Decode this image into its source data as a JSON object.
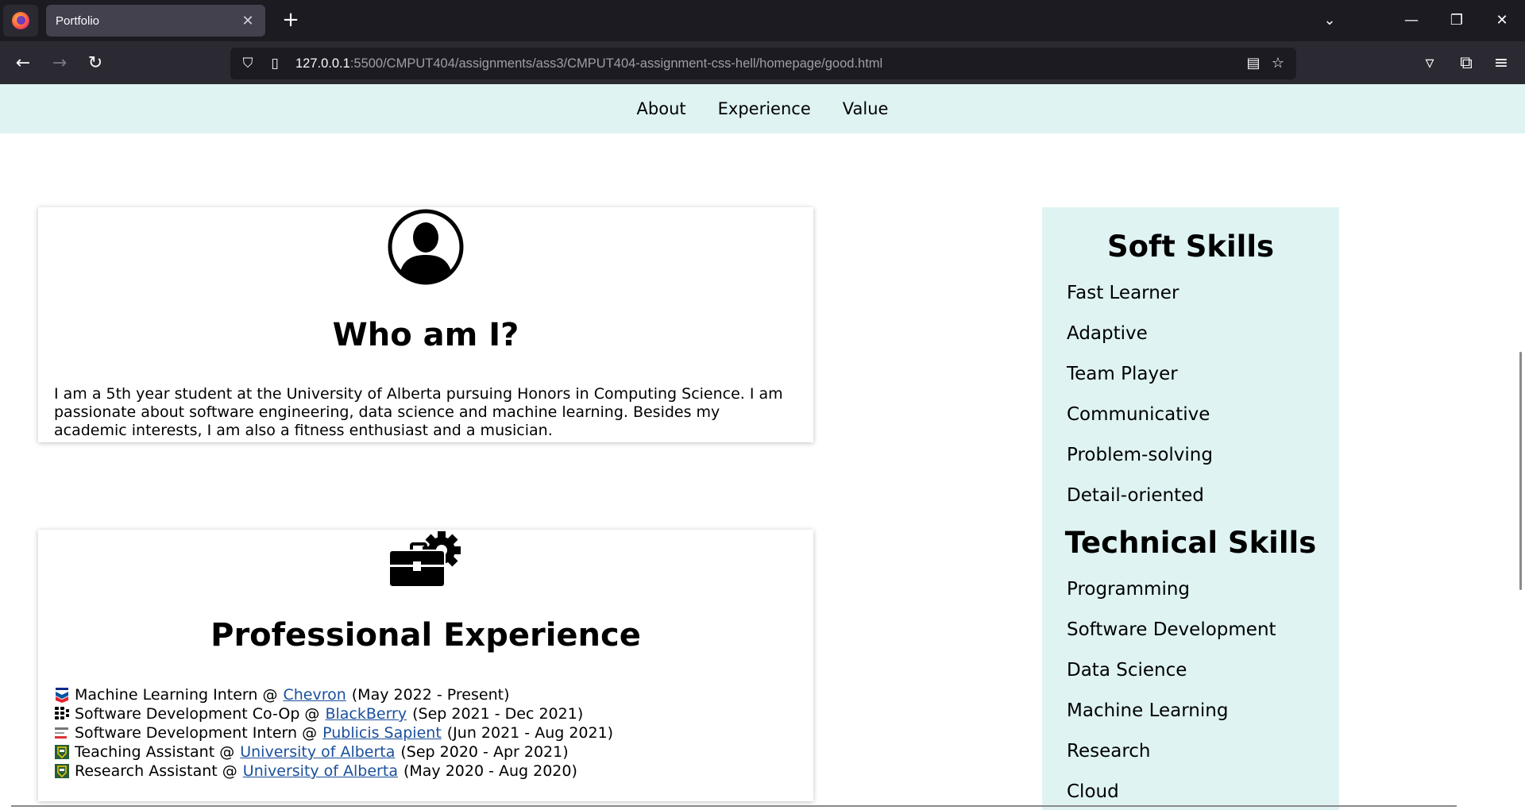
{
  "browser": {
    "tab_title": "Portfolio",
    "url_host": "127.0.0.1",
    "url_rest": ":5500/CMPUT404/assignments/ass3/CMPUT404-assignment-css-hell/homepage/good.html"
  },
  "site_nav": {
    "items": [
      "About",
      "Experience",
      "Value"
    ]
  },
  "about": {
    "title": "Who am I?",
    "text": "I am a 5th year student at the University of Alberta pursuing Honors in Computing Science. I am passionate about software engineering, data science and machine learning. Besides my academic interests, I am also a fitness enthusiast and a musician."
  },
  "experience": {
    "title": "Professional Experience",
    "items": [
      {
        "role": "Machine Learning Intern @",
        "company": "Chevron",
        "dates": "(May 2022 - Present)",
        "logo": "chevron-logo"
      },
      {
        "role": "Software Development Co-Op @",
        "company": "BlackBerry",
        "dates": "(Sep 2021 - Dec 2021)",
        "logo": "blackberry-logo"
      },
      {
        "role": "Software Development Intern @",
        "company": "Publicis Sapient",
        "dates": "(Jun 2021 - Aug 2021)",
        "logo": "publicis-sapient-logo"
      },
      {
        "role": "Teaching Assistant @",
        "company": "University of Alberta",
        "dates": "(Sep 2020 - Apr 2021)",
        "logo": "ualberta-logo"
      },
      {
        "role": "Research Assistant @",
        "company": "University of Alberta",
        "dates": "(May 2020 - Aug 2020)",
        "logo": "ualberta-logo"
      }
    ]
  },
  "skills": {
    "soft_title": "Soft Skills",
    "soft": [
      "Fast Learner",
      "Adaptive",
      "Team Player",
      "Communicative",
      "Problem-solving",
      "Detail-oriented"
    ],
    "technical_title": "Technical Skills",
    "technical": [
      "Programming",
      "Software Development",
      "Data Science",
      "Machine Learning",
      "Research",
      "Cloud"
    ]
  },
  "colors": {
    "nav_bg": "#dff3f3",
    "link": "#1a4f9c",
    "chrome_bg": "#1c1b22"
  }
}
